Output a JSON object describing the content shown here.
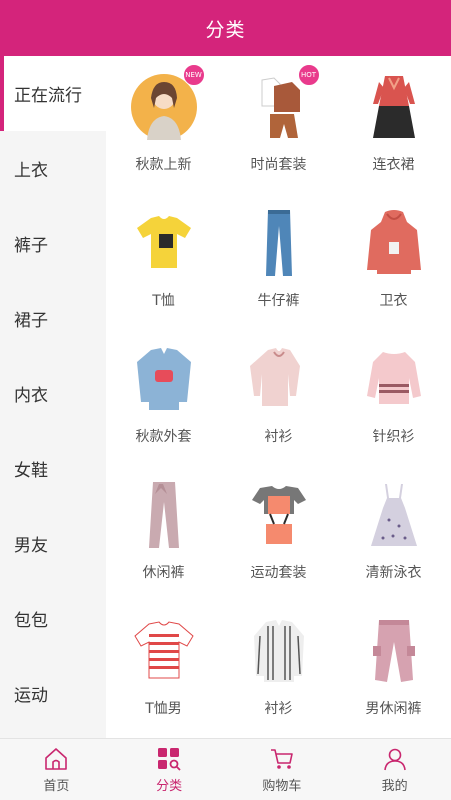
{
  "header": {
    "title": "分类"
  },
  "sidebar": {
    "items": [
      {
        "label": "正在流行"
      },
      {
        "label": "上衣"
      },
      {
        "label": "裤子"
      },
      {
        "label": "裙子"
      },
      {
        "label": "内衣"
      },
      {
        "label": "女鞋"
      },
      {
        "label": "男友"
      },
      {
        "label": "包包"
      },
      {
        "label": "运动"
      }
    ]
  },
  "products": [
    {
      "label": "秋款上新",
      "badge": "NEW",
      "icon": "girl-portrait-icon",
      "color": "#f3b24a"
    },
    {
      "label": "时尚套装",
      "badge": "HOT",
      "icon": "outfit-set-icon",
      "color": "#b0643a"
    },
    {
      "label": "连衣裙",
      "icon": "dress-icon",
      "color": "#d9544f"
    },
    {
      "label": "T恤",
      "icon": "tshirt-icon",
      "color": "#f5d33a"
    },
    {
      "label": "牛仔裤",
      "icon": "jeans-icon",
      "color": "#4f86b8"
    },
    {
      "label": "卫衣",
      "icon": "hoodie-icon",
      "color": "#e06b5f"
    },
    {
      "label": "秋款外套",
      "icon": "denim-jacket-icon",
      "color": "#8cb3d6"
    },
    {
      "label": "衬衫",
      "icon": "blouse-icon",
      "color": "#f0d2d0"
    },
    {
      "label": "针织衫",
      "icon": "knit-sweater-icon",
      "color": "#f4c9cc"
    },
    {
      "label": "休闲裤",
      "icon": "casual-pants-icon",
      "color": "#c9aab0"
    },
    {
      "label": "运动套装",
      "icon": "sport-set-icon",
      "color": "#f58a6e"
    },
    {
      "label": "清新泳衣",
      "icon": "floral-dress-icon",
      "color": "#d4d0df"
    },
    {
      "label": "T恤男",
      "icon": "striped-tee-icon",
      "color": "#e04848"
    },
    {
      "label": "衬衫",
      "icon": "striped-shirt-icon",
      "color": "#555555"
    },
    {
      "label": "男休闲裤",
      "icon": "jogger-pants-icon",
      "color": "#d6a2b0"
    }
  ],
  "tabbar": {
    "items": [
      {
        "label": "首页",
        "icon": "home-icon"
      },
      {
        "label": "分类",
        "icon": "category-icon"
      },
      {
        "label": "购物车",
        "icon": "cart-icon"
      },
      {
        "label": "我的",
        "icon": "user-icon"
      }
    ],
    "active_color": "#c9276f"
  },
  "colors": {
    "brand": "#d4247b"
  }
}
